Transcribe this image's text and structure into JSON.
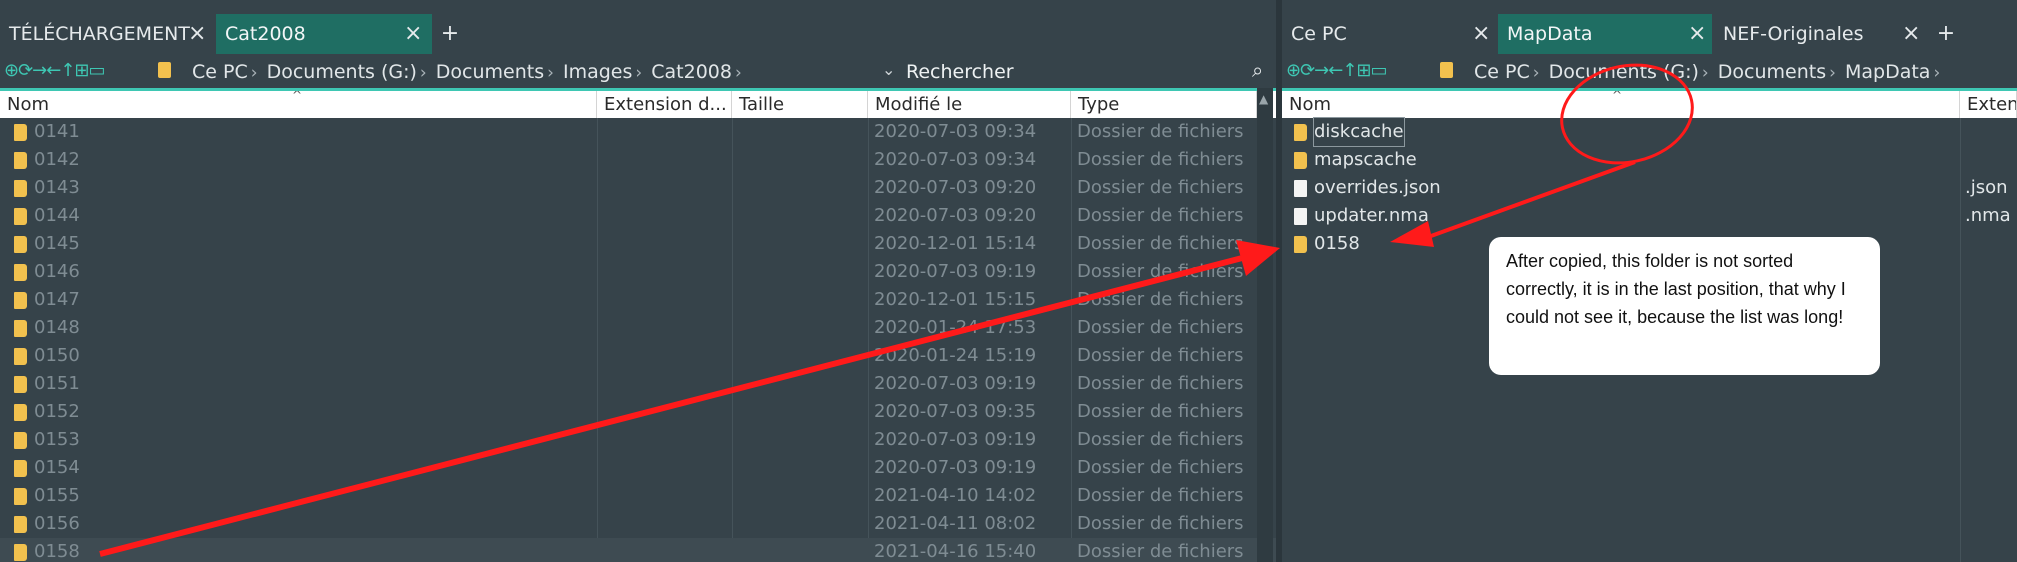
{
  "left": {
    "tabs": [
      {
        "label": "TÉLÉCHARGEMENT",
        "active": false
      },
      {
        "label": "Cat2008",
        "active": true
      }
    ],
    "breadcrumb": [
      "Ce PC",
      "Documents (G:)",
      "Documents",
      "Images",
      "Cat2008"
    ],
    "search_placeholder": "Rechercher",
    "columns": {
      "name": "Nom",
      "ext": "Extension d...",
      "size": "Taille",
      "modified": "Modifié le",
      "type": "Type"
    },
    "rows": [
      {
        "name": "0141",
        "modified": "2020-07-03 09:34",
        "type": "Dossier de fichiers"
      },
      {
        "name": "0142",
        "modified": "2020-07-03 09:34",
        "type": "Dossier de fichiers"
      },
      {
        "name": "0143",
        "modified": "2020-07-03 09:20",
        "type": "Dossier de fichiers"
      },
      {
        "name": "0144",
        "modified": "2020-07-03 09:20",
        "type": "Dossier de fichiers"
      },
      {
        "name": "0145",
        "modified": "2020-12-01 15:14",
        "type": "Dossier de fichiers"
      },
      {
        "name": "0146",
        "modified": "2020-07-03 09:19",
        "type": "Dossier de fichiers"
      },
      {
        "name": "0147",
        "modified": "2020-12-01 15:15",
        "type": "Dossier de fichiers"
      },
      {
        "name": "0148",
        "modified": "2020-01-24 17:53",
        "type": "Dossier de fichiers"
      },
      {
        "name": "0150",
        "modified": "2020-01-24 15:19",
        "type": "Dossier de fichiers"
      },
      {
        "name": "0151",
        "modified": "2020-07-03 09:19",
        "type": "Dossier de fichiers"
      },
      {
        "name": "0152",
        "modified": "2020-07-03 09:35",
        "type": "Dossier de fichiers"
      },
      {
        "name": "0153",
        "modified": "2020-07-03 09:19",
        "type": "Dossier de fichiers"
      },
      {
        "name": "0154",
        "modified": "2020-07-03 09:19",
        "type": "Dossier de fichiers"
      },
      {
        "name": "0155",
        "modified": "2021-04-10 14:02",
        "type": "Dossier de fichiers"
      },
      {
        "name": "0156",
        "modified": "2021-04-11 08:02",
        "type": "Dossier de fichiers"
      },
      {
        "name": "0158",
        "modified": "2021-04-16 15:40",
        "type": "Dossier de fichiers"
      }
    ]
  },
  "right": {
    "tabs": [
      {
        "label": "Ce PC",
        "active": false
      },
      {
        "label": "MapData",
        "active": true
      },
      {
        "label": "NEF-Originales",
        "active": false
      }
    ],
    "breadcrumb": [
      "Ce PC",
      "Documents (G:)",
      "Documents",
      "MapData"
    ],
    "columns": {
      "name": "Nom",
      "ext": "Extens"
    },
    "rows": [
      {
        "name": "diskcache",
        "ext": "",
        "kind": "folder"
      },
      {
        "name": "mapscache",
        "ext": "",
        "kind": "folder"
      },
      {
        "name": "overrides.json",
        "ext": ".json",
        "kind": "file"
      },
      {
        "name": "updater.nma",
        "ext": ".nma",
        "kind": "file"
      },
      {
        "name": "0158",
        "ext": "",
        "kind": "folder"
      }
    ]
  },
  "callout_text": "After copied, this folder is not sorted correctly, it is in the last position, that why I could not see it, because the list was long!",
  "colors": {
    "accent": "#1f6e63",
    "annotation": "#ff1a1a",
    "folder": "#f2c14e"
  }
}
